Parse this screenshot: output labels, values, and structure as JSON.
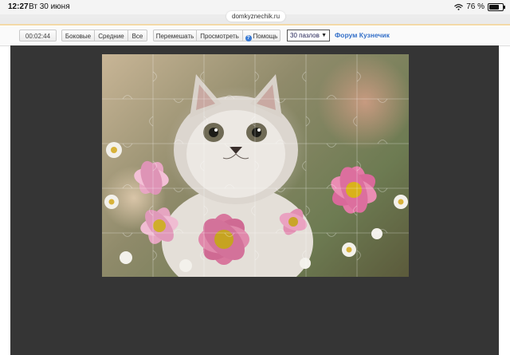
{
  "status_bar": {
    "time": "12:27",
    "date": "Вт 30 июня",
    "battery": "76 %",
    "battery_level": 0.76
  },
  "browser": {
    "url": "domkyznechik.ru"
  },
  "toolbar": {
    "timer": "00:02:44",
    "edges_label": "Боковые",
    "middle_label": "Средние",
    "all_label": "Все",
    "shuffle_label": "Перемешать",
    "preview_label": "Просмотреть",
    "help_label": "Помощь",
    "pieces_selected": "30 пазлов",
    "forum_link": "Форум Кузнечик"
  },
  "colors": {
    "board_background": "#353535",
    "link": "#3470c9",
    "accent_line": "#f3d9a6"
  },
  "icons": {
    "help": "question-circle-icon",
    "wifi": "wifi-icon",
    "battery": "battery-icon",
    "dropdown": "chevron-down-icon"
  }
}
